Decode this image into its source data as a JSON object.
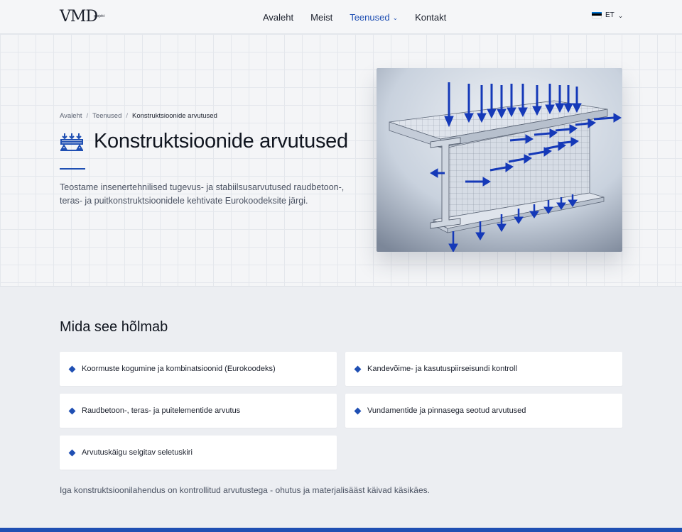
{
  "header": {
    "logo_text": "VMD",
    "logo_sub": "projekt",
    "nav": [
      {
        "label": "Avaleht"
      },
      {
        "label": "Meist"
      },
      {
        "label": "Teenused"
      },
      {
        "label": "Kontakt"
      }
    ],
    "language": "ET"
  },
  "hero": {
    "breadcrumb": [
      "Avaleht",
      "Teenused",
      "Konstruktsioonide arvutused"
    ],
    "breadcrumb_sep": "/",
    "title": "Konstruktsioonide arvutused",
    "intro": "Teostame insenertehnilised tugevus- ja stabiilsusarvutused raudbetoon-, teras- ja puitkonstruktsioonidele kehtivate Eurokoodeksite järgi."
  },
  "section": {
    "title": "Mida see hõlmab",
    "items": [
      "Koormuste kogumine ja kombinatsioonid (Eurokoodeks)",
      "Kandevõime- ja kasutuspiirseisundi kontroll",
      "Raudbetoon-, teras- ja puitelementide arvutus",
      "Vundamentide ja pinnasega seotud arvutused",
      "Arvutuskäigu selgitav seletuskiri"
    ],
    "closing": "Iga konstruktsioonilahendus on kontrollitud arvutustega - ohutus ja materjalisääst käivad käsikäes."
  },
  "colors": {
    "accent": "#1f4fb3",
    "flag": [
      "#0072ce",
      "#000000",
      "#ffffff"
    ]
  }
}
